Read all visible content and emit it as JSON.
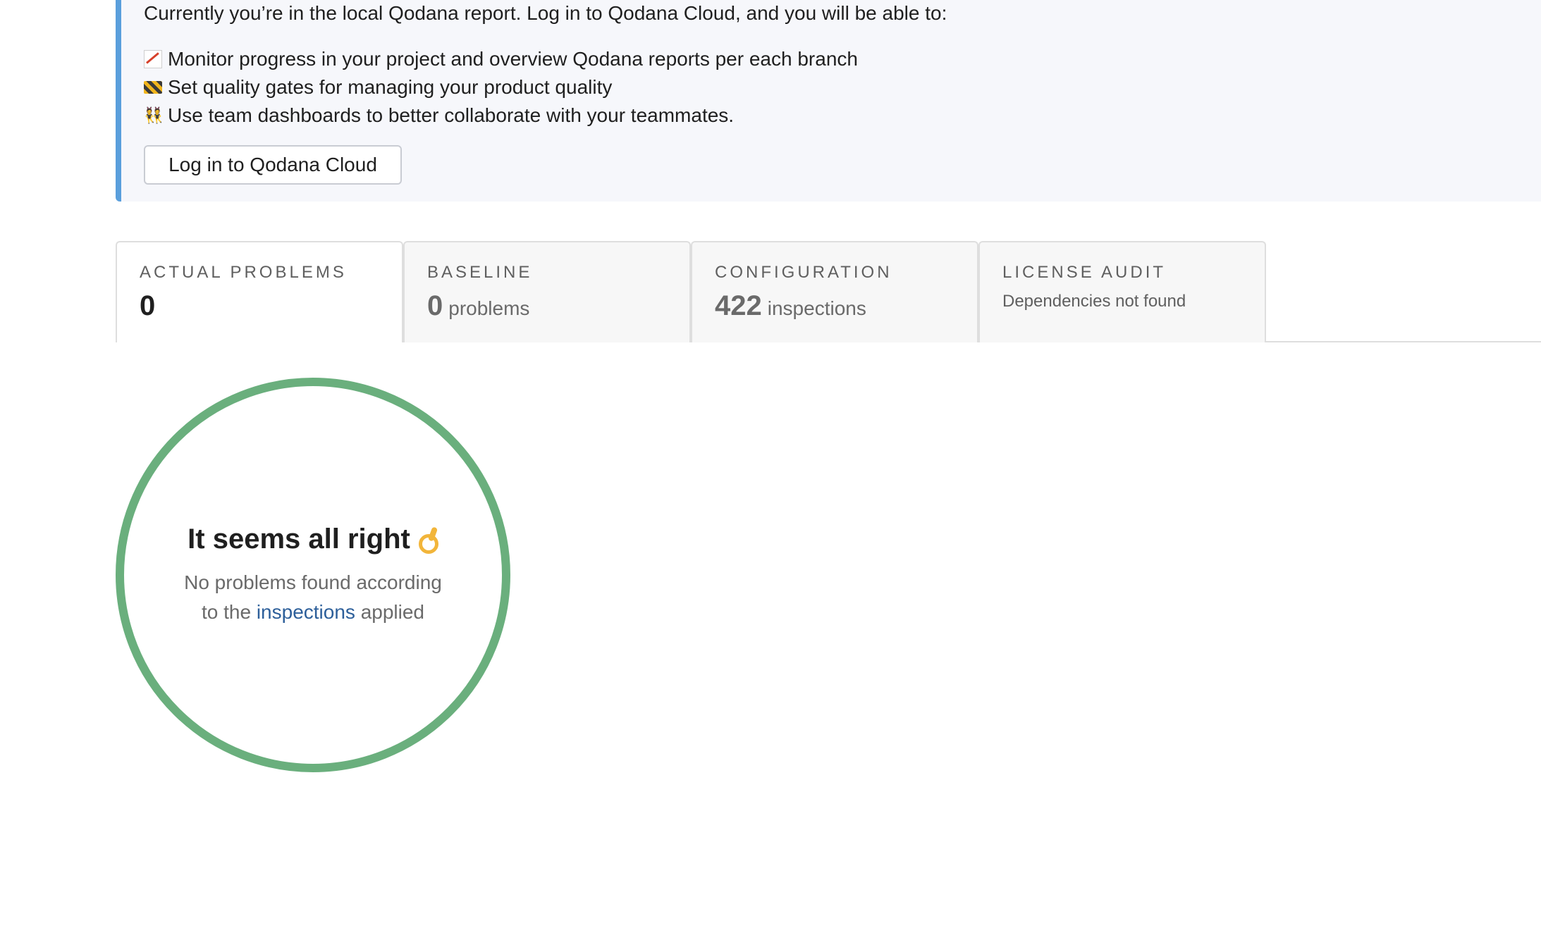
{
  "banner": {
    "intro": "Currently you’re in the local Qodana report. Log in to Qodana Cloud, and you will be able to:",
    "benefits": [
      {
        "icon": "chart-increasing-icon",
        "text": "Monitor progress in your project and overview Qodana reports per each branch"
      },
      {
        "icon": "construction-icon",
        "text": "Set quality gates for managing your product quality"
      },
      {
        "icon": "team-icon",
        "text": "Use team dashboards to better collaborate with your teammates."
      }
    ],
    "login_label": "Log in to Qodana Cloud"
  },
  "tabs": [
    {
      "label": "ACTUAL PROBLEMS",
      "number": "0",
      "active": true
    },
    {
      "label": "BASELINE",
      "number": "0",
      "unit": "problems"
    },
    {
      "label": "CONFIGURATION",
      "number": "422",
      "unit": "inspections"
    },
    {
      "label": "LICENSE AUDIT",
      "note": "Dependencies not found"
    }
  ],
  "result": {
    "title": "It seems all right",
    "line1": "No problems found according",
    "line2_prefix": "to the",
    "link": "inspections",
    "line2_suffix": "applied"
  },
  "colors": {
    "accent_border": "#5a9fdc",
    "success": "#6aaf7d",
    "link": "#2d5f9a"
  }
}
